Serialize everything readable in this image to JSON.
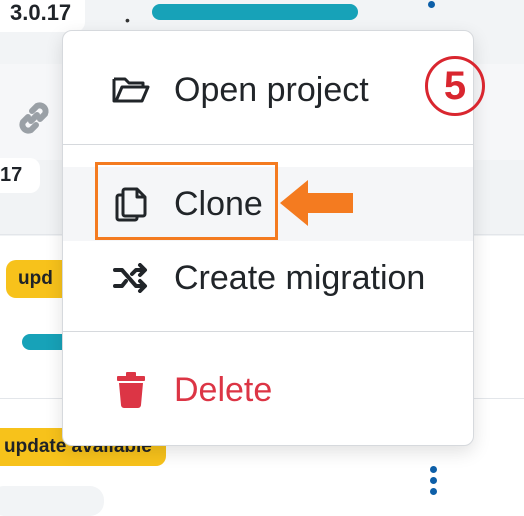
{
  "background": {
    "version_top": "3.0.17",
    "version_second": "17",
    "badge_partial": "upd",
    "badge_update": "update available"
  },
  "menu": {
    "items": [
      {
        "label": "Open project",
        "icon": "folder-open-icon"
      },
      {
        "label": "Clone",
        "icon": "copy-icon"
      },
      {
        "label": "Create migration",
        "icon": "shuffle-icon"
      },
      {
        "label": "Delete",
        "icon": "trash-icon"
      }
    ]
  },
  "annotation": {
    "step_number": "5",
    "highlight_color": "#f47b20",
    "step_color": "#d9262f"
  },
  "colors": {
    "accent_bar": "#17a2b8",
    "badge_yellow": "#f7c21b",
    "danger": "#dc3545"
  }
}
